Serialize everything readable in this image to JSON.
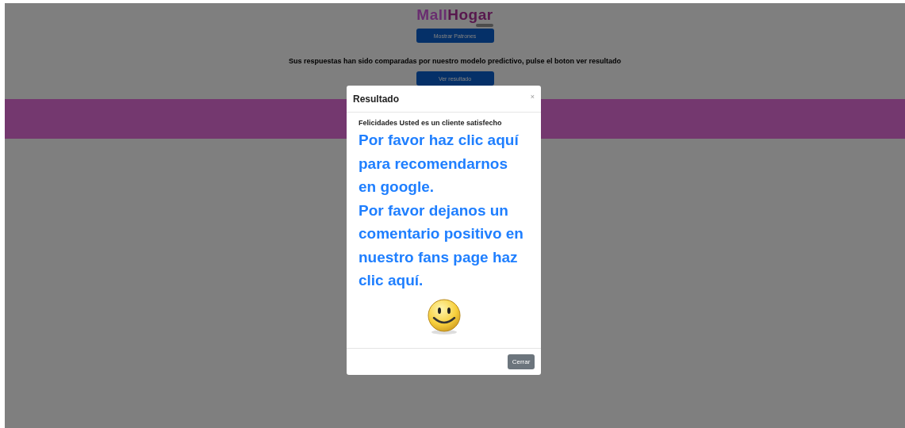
{
  "logo": {
    "part_1": "Mall",
    "part_2": "Hogar"
  },
  "buttons": [
    "Mostrar Patrones"
  ],
  "message": "Sus respuestas han sido comparadas por nuestro modelo predictivo, pulse el boton ver resultado",
  "result_button": "Ver resultado",
  "modal": {
    "title": "Resultado",
    "close": "×",
    "intro": "Felicidades Usted es un cliente satisfecho",
    "paragraphs": [
      "Por favor haz clic aquí para recomendarnos en google.",
      "Por favor dejanos un comentario positivo en nuestro fans page haz clic aquí."
    ],
    "footer_button": "Cerrar"
  }
}
